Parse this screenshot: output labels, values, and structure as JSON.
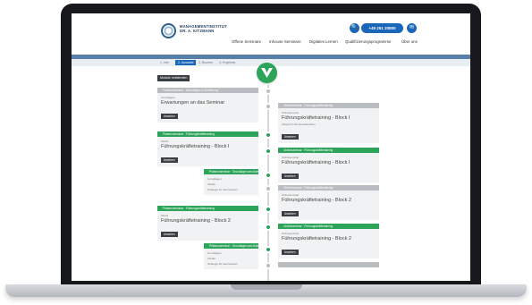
{
  "header": {
    "logo_line1": "MANAGEMENTINSTITUT",
    "logo_line2": "DR. A. KITZMANN",
    "phone": "+49 251 20800",
    "search_glyph": "🔍",
    "mail_glyph": "✉",
    "nav": [
      "Offene Seminare",
      "Inhouse Seminare",
      "Digitales Lernen",
      "Qualifizierungsprogramme",
      "Über uns"
    ]
  },
  "steps": [
    "1. Info",
    "2. Auswahl",
    "3. Buchen",
    "4. Ergebnis"
  ],
  "dropdown_label": "Module einblenden",
  "colors": {
    "accent_blue": "#1a66b8",
    "accent_green": "#2ca45a"
  },
  "left_cards": [
    {
      "bar": "Präsenzseminar · Grundlagen & Einführung",
      "label": "Grundlagen",
      "title": "Erwartungen an das Seminar",
      "sub": "",
      "button": "Ansehen",
      "tone": "grey"
    },
    {
      "bar": "Präsenzseminar · Führungskräftetraining",
      "label": "Modul",
      "title": "Führungskräftetraining - Block I",
      "sub": "",
      "button": "Ansehen",
      "tone": "green"
    },
    {
      "bar": "Präsenzseminar · Führungskräftetraining",
      "label": "Modul",
      "title": "Führungskräftetraining - Block 2",
      "sub": "",
      "button": "Ansehen",
      "tone": "green"
    }
  ],
  "right_cards": [
    {
      "bar": "Onlineseminar · Führungskräftetraining",
      "label": "Onlineseminar",
      "title": "Führungskräftetraining - Block I",
      "sub": "Ablauf für Seminarteilnahme",
      "button": "Ansehen",
      "tone": "grey"
    },
    {
      "bar": "Onlineseminar · Führungskräftetraining",
      "label": "Onlineseminar",
      "title": "Führungskräftetraining - Block I",
      "sub": "",
      "button": "Ansehen",
      "tone": "green"
    },
    {
      "bar": "Onlineseminar · Führungskräftetraining",
      "label": "Onlineseminar",
      "title": "Führungskräftetraining - Block 2",
      "sub": "",
      "button": "Ansehen",
      "tone": "grey"
    },
    {
      "bar": "Onlineseminar · Führungskräftetraining",
      "label": "Onlineseminar",
      "title": "Führungskräftetraining - Block 2",
      "sub": "",
      "button": "Ansehen",
      "tone": "green"
    }
  ],
  "small_cards": [
    {
      "bar": "Präsenzseminar · Grundlagen am Arbeitsplatz",
      "label": "Grundlagen",
      "sub1": "Inhalte",
      "sub2": "Strategie für das Arbeiten"
    },
    {
      "bar": "Präsenzseminar · Grundlagen am Arbeitsplatz",
      "label": "Grundlagen",
      "sub1": "Inhalte",
      "sub2": "Strategie für das Arbeiten"
    }
  ]
}
